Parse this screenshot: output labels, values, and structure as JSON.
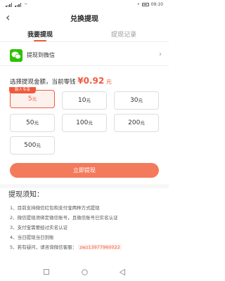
{
  "status": {
    "time": "09:10"
  },
  "header": {
    "back": "‹",
    "title": "兑换提现"
  },
  "tabs": [
    {
      "label": "我要提现",
      "active": true
    },
    {
      "label": "提现记录",
      "active": false
    }
  ],
  "wechat": {
    "label": "提现到微信",
    "arrow": "›"
  },
  "amount": {
    "prefix": "选择提现金额，当前零钱",
    "currency": "¥",
    "value": "0.92",
    "unit": "元"
  },
  "badge": "新人专享",
  "options": [
    {
      "value": "5",
      "unit": "元",
      "selected": true
    },
    {
      "value": "10",
      "unit": "元"
    },
    {
      "value": "30",
      "unit": "元"
    },
    {
      "value": "50",
      "unit": "元"
    },
    {
      "value": "100",
      "unit": "元"
    },
    {
      "value": "200",
      "unit": "元"
    },
    {
      "value": "500",
      "unit": "元"
    }
  ],
  "submit_label": "立即提现",
  "notes": {
    "title": "提现须知：",
    "items": [
      "1、目前支持微信红包和支付宝两种方式提现",
      "2、微信提现须绑定微信账号，且微信账号已实名认证",
      "3、支付宝需要经过实名认证",
      "4、当日提现当日到账",
      "5、若有疑问，请咨询微信客服："
    ],
    "wechat_id": "zwz13977960022"
  },
  "colors": {
    "accent": "#f05a3c",
    "button": "#f47a5c",
    "wechat": "#2dc100"
  },
  "nav_icons": [
    "square-icon",
    "circle-icon",
    "triangle-back-icon"
  ]
}
